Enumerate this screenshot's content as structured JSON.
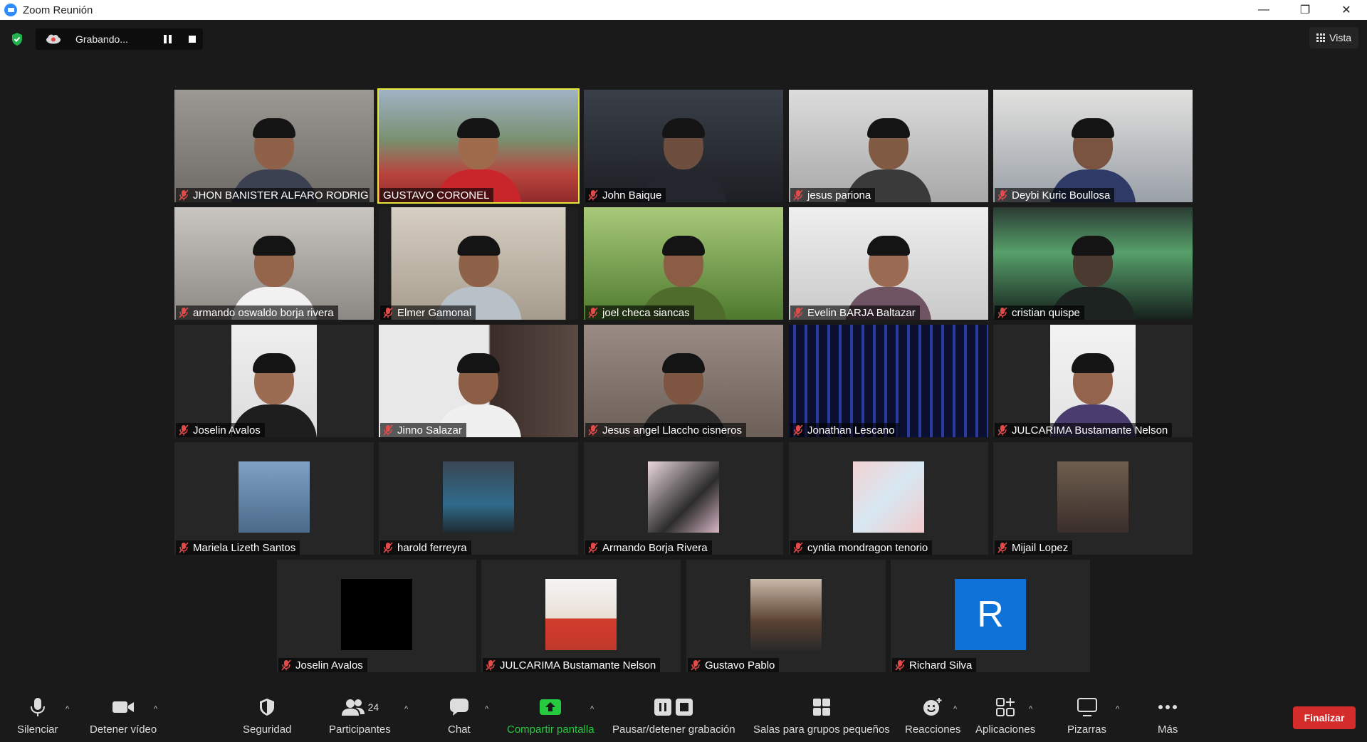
{
  "window": {
    "title": "Zoom Reunión",
    "minimize": "—",
    "restore": "❐",
    "close": "✕"
  },
  "topbar": {
    "recording_label": "Grabando...",
    "view_label": "Vista"
  },
  "participants": [
    {
      "name": "JHON BANISTER ALFARO RODRIG...",
      "muted": true
    },
    {
      "name": "GUSTAVO CORONEL",
      "muted": false,
      "active_speaker": true
    },
    {
      "name": "John Baique",
      "muted": true
    },
    {
      "name": "jesus pariona",
      "muted": true
    },
    {
      "name": "Deybi Kuric Boullosa",
      "muted": true
    },
    {
      "name": "armando oswaldo borja rivera",
      "muted": true
    },
    {
      "name": "Elmer Gamonal",
      "muted": true
    },
    {
      "name": "joel checa siancas",
      "muted": true
    },
    {
      "name": "Evelin BARJA  Baltazar",
      "muted": true
    },
    {
      "name": "cristian quispe",
      "muted": true
    },
    {
      "name": "Joselin Avalos",
      "muted": true
    },
    {
      "name": "Jinno Salazar",
      "muted": true
    },
    {
      "name": "Jesus angel Llaccho cisneros",
      "muted": true
    },
    {
      "name": "Jonathan Lescano",
      "muted": true
    },
    {
      "name": "JULCARIMA Bustamante Nelson",
      "muted": true
    },
    {
      "name": "Mariela Lizeth Santos",
      "muted": true
    },
    {
      "name": "harold ferreyra",
      "muted": true
    },
    {
      "name": "Armando Borja Rivera",
      "muted": true
    },
    {
      "name": "cyntia mondragon tenorio",
      "muted": true
    },
    {
      "name": "Mijail Lopez",
      "muted": true
    },
    {
      "name": "Joselin Avalos",
      "muted": true
    },
    {
      "name": "JULCARIMA Bustamante Nelson",
      "muted": true
    },
    {
      "name": "Gustavo Pablo",
      "muted": true
    },
    {
      "name": "Richard Silva",
      "muted": true,
      "avatar_letter": "R"
    }
  ],
  "toolbar": {
    "mute": "Silenciar",
    "video": "Detener vídeo",
    "security": "Seguridad",
    "participants": "Participantes",
    "participants_count": "24",
    "chat": "Chat",
    "share": "Compartir pantalla",
    "recording": "Pausar/detener grabación",
    "breakout": "Salas para grupos pequeños",
    "reactions": "Reacciones",
    "apps": "Aplicaciones",
    "whiteboards": "Pizarras",
    "more": "Más",
    "end": "Finalizar"
  },
  "colors": {
    "accent_green": "#27c93f",
    "end_red": "#d42b2b",
    "active_speaker": "#e8e53a",
    "avatar_blue": "#0e72d8",
    "mute_red": "#e34b4b"
  }
}
